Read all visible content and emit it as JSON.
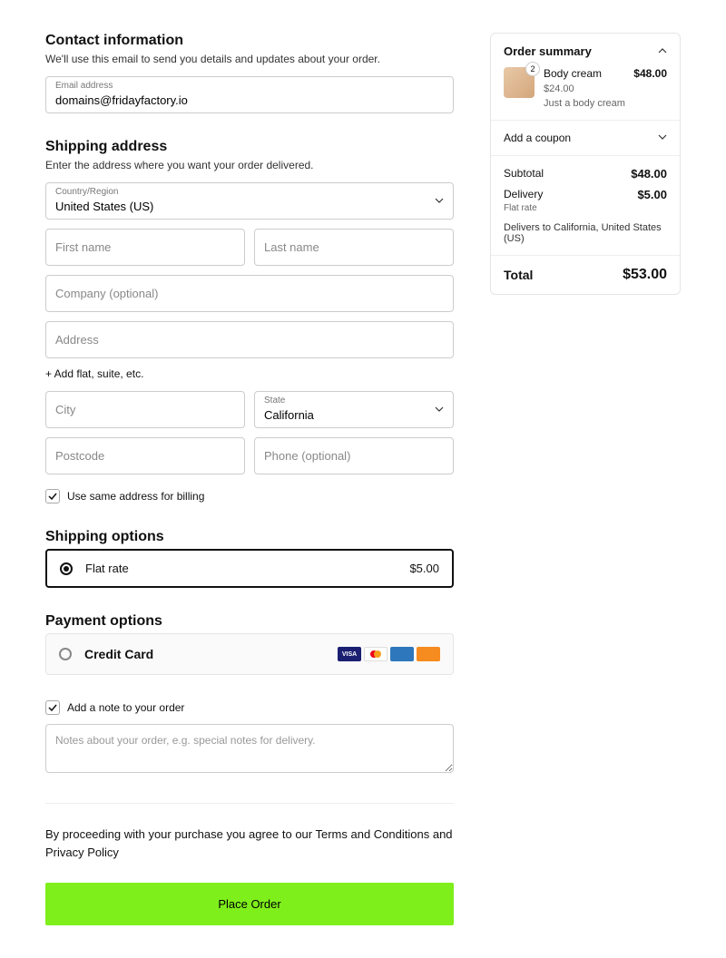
{
  "contact": {
    "heading": "Contact information",
    "desc": "We'll use this email to send you details and updates about your order.",
    "email_label": "Email address",
    "email_value": "domains@fridayfactory.io"
  },
  "shipping": {
    "heading": "Shipping address",
    "desc": "Enter the address where you want your order delivered.",
    "country_label": "Country/Region",
    "country_value": "United States (US)",
    "first_name_placeholder": "First name",
    "last_name_placeholder": "Last name",
    "company_placeholder": "Company (optional)",
    "address_placeholder": "Address",
    "add_flat_label": "+ Add flat, suite, etc.",
    "city_placeholder": "City",
    "state_label": "State",
    "state_value": "California",
    "postcode_placeholder": "Postcode",
    "phone_placeholder": "Phone (optional)",
    "same_billing_label": "Use same address for billing"
  },
  "shipping_options": {
    "heading": "Shipping options",
    "flat_rate_label": "Flat rate",
    "flat_rate_price": "$5.00"
  },
  "payment": {
    "heading": "Payment options",
    "credit_card_label": "Credit Card"
  },
  "notes": {
    "checkbox_label": "Add a note to your order",
    "placeholder": "Notes about your order, e.g. special notes for delivery."
  },
  "terms_text": "By proceeding with your purchase you agree to our Terms and Conditions and Privacy Policy",
  "place_order_label": "Place Order",
  "summary": {
    "heading": "Order summary",
    "item": {
      "qty": "2",
      "name": "Body cream",
      "total": "$48.00",
      "unit": "$24.00",
      "desc": "Just a body cream"
    },
    "coupon_label": "Add a coupon",
    "subtotal_label": "Subtotal",
    "subtotal_value": "$48.00",
    "delivery_label": "Delivery",
    "delivery_value": "$5.00",
    "delivery_sub": "Flat rate",
    "delivers_to": "Delivers to California, United States (US)",
    "total_label": "Total",
    "total_value": "$53.00"
  }
}
